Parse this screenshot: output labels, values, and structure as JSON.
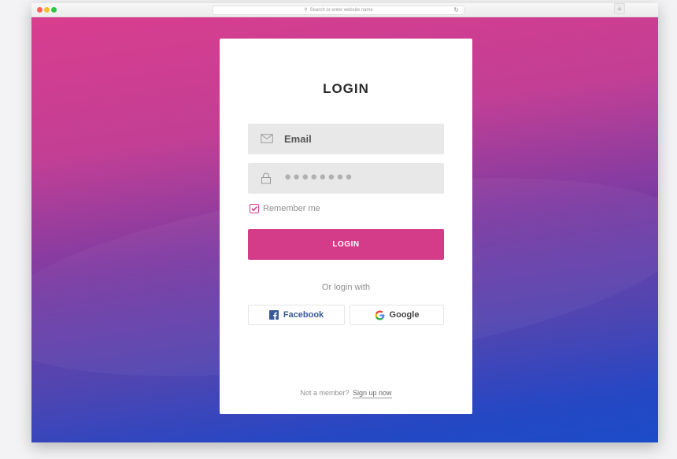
{
  "browser": {
    "address_placeholder": "Search or enter website name",
    "new_tab_label": "+"
  },
  "login_card": {
    "title": "LOGIN",
    "email_placeholder": "Email",
    "password_mask": "●●●●●●●●",
    "remember_label": "Remember me",
    "remember_checked": true,
    "login_button": "LOGIN",
    "or_login_with": "Or login with",
    "facebook_label": "Facebook",
    "google_label": "Google",
    "signup_prompt": "Not a member?",
    "signup_link": "Sign up now"
  },
  "colors": {
    "accent": "#d43c8a",
    "gradient_top": "#d93d8e",
    "gradient_bottom": "#1b4cc8",
    "facebook": "#3b5998"
  },
  "icons": {
    "email": "envelope-icon",
    "password": "lock-icon",
    "checkbox": "check-icon",
    "facebook": "facebook-icon",
    "google": "google-icon",
    "search": "search-icon",
    "reload": "reload-icon"
  }
}
